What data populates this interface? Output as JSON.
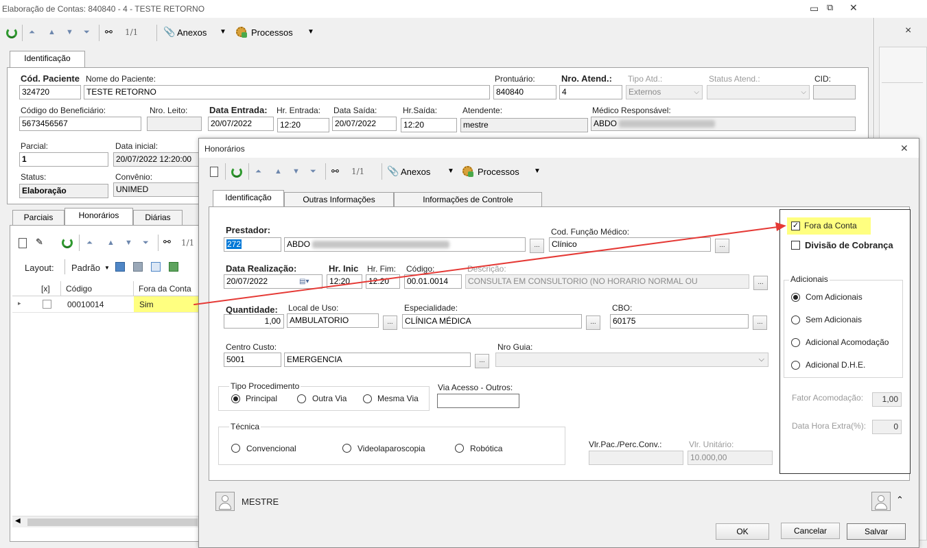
{
  "main": {
    "title": "Elaboração de Contas: 840840 - 4 - TESTE RETORNO",
    "toolbar": {
      "counter": "1/1",
      "anexos": "Anexos",
      "processos": "Processos"
    },
    "tab": "Identificação",
    "labels": {
      "cod_paciente": "Cód. Paciente",
      "nome_paciente": "Nome do Paciente:",
      "prontuario": "Prontuário:",
      "nro_atend": "Nro. Atend.:",
      "tipo_atd": "Tipo Atd.:",
      "status_atend": "Status Atend.:",
      "cid": "CID:",
      "cod_beneficiario": "Código do Beneficiário:",
      "nro_leito": "Nro. Leito:",
      "data_entrada": "Data Entrada:",
      "hr_entrada": "Hr. Entrada:",
      "data_saida": "Data Saída:",
      "hr_saida": "Hr.Saída:",
      "atendente": "Atendente:",
      "medico": "Médico Responsável:",
      "parcial": "Parcial:",
      "data_inicial": "Data inicial:",
      "status": "Status:",
      "convenio": "Convênio:"
    },
    "values": {
      "cod_paciente": "324720",
      "nome_paciente": "TESTE RETORNO",
      "prontuario": "840840",
      "nro_atend": "4",
      "tipo_atd": "Externos",
      "cod_beneficiario": "5673456567",
      "data_entrada": "20/07/2022",
      "hr_entrada": "12:20",
      "data_saida": "20/07/2022",
      "hr_saida": "12:20",
      "atendente": "mestre",
      "medico": "ABDO",
      "parcial": "1",
      "data_inicial": "20/07/2022 12:20:00",
      "status": "Elaboração",
      "convenio": "UNIMED"
    },
    "sub_tabs": [
      "Parciais",
      "Honorários",
      "Diárias"
    ],
    "grid_toolbar": {
      "counter": "1/1",
      "layout": "Layout:",
      "padrao": "Padrão"
    },
    "grid": {
      "headers": [
        "[x]",
        "Código",
        "Fora da Conta"
      ],
      "row": {
        "codigo": "00010014",
        "fora": "Sim"
      }
    },
    "side_close": "×"
  },
  "dialog": {
    "title": "Honorários",
    "toolbar": {
      "counter": "1/1",
      "anexos": "Anexos",
      "processos": "Processos"
    },
    "tabs": [
      "Identificação",
      "Outras Informações",
      "Informações de Controle"
    ],
    "labels": {
      "prestador": "Prestador:",
      "cod_funcao": "Cod. Função Médico:",
      "data_realizacao": "Data Realização:",
      "hr_inic": "Hr. Inic",
      "hr_fim": "Hr. Fim:",
      "codigo": "Código:",
      "descricao": "Descrição:",
      "quantidade": "Quantidade:",
      "local_uso": "Local de Uso:",
      "especialidade": "Especialidade:",
      "cbo": "CBO:",
      "centro_custo": "Centro Custo:",
      "nro_guia": "Nro Guia:",
      "tipo_proc": "Tipo Procedimento",
      "via_acesso": "Via Acesso - Outros:",
      "tecnica": "Técnica",
      "vlr_pac": "Vlr.Pac./Perc.Conv.:",
      "vlr_unit": "Vlr. Unitário:"
    },
    "values": {
      "prestador_cod": "272",
      "prestador_nome": "ABDO",
      "cod_funcao": "Clínico",
      "data_realizacao": "20/07/2022",
      "hr_inic": "12:20",
      "hr_fim": "12:20",
      "codigo": "00.01.0014",
      "descricao": "CONSULTA EM CONSULTORIO (NO HORARIO NORMAL OU",
      "quantidade": "1,00",
      "local_uso": "AMBULATORIO",
      "especialidade": "CLÍNICA MÉDICA",
      "cbo": "60175",
      "centro_custo_cod": "5001",
      "centro_custo_nome": "EMERGENCIA",
      "vlr_unit": "10.000,00"
    },
    "tipo_options": [
      "Principal",
      "Outra Via",
      "Mesma Via"
    ],
    "tecnica_options": [
      "Convencional",
      "Videolaparoscopia",
      "Robótica"
    ],
    "right_panel": {
      "fora_conta": "Fora da Conta",
      "divisao": "Divisão de Cobrança",
      "adicionais": "Adicionais",
      "options": [
        "Com Adicionais",
        "Sem Adicionais",
        "Adicional Acomodação",
        "Adicional D.H.E."
      ],
      "fator_label": "Fator Acomodação:",
      "fator_value": "1,00",
      "extra_label": "Data Hora Extra(%):",
      "extra_value": "0"
    },
    "user": "MESTRE",
    "buttons": {
      "ok": "OK",
      "cancelar": "Cancelar",
      "salvar": "Salvar"
    }
  },
  "colors": {
    "highlight": "#ffff80",
    "arrow": "#e53935",
    "selection": "#0078d7"
  }
}
